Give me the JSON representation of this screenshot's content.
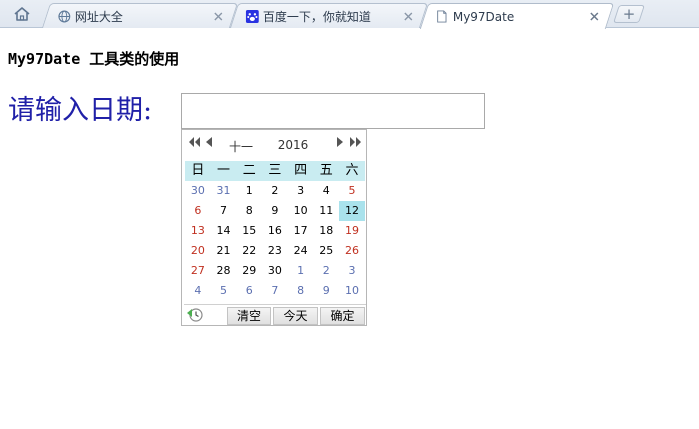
{
  "browser": {
    "tabs": [
      {
        "title": "网址大全",
        "icon": "globe-icon",
        "active": false
      },
      {
        "title": "百度一下，你就知道",
        "icon": "baidu-paw-icon",
        "active": false
      },
      {
        "title": "My97Date",
        "icon": "page-icon",
        "active": true
      }
    ],
    "new_tab_label": "+"
  },
  "page": {
    "heading": "My97Date 工具类的使用",
    "label": "请输入日期:",
    "input_value": ""
  },
  "calendar": {
    "month": "十一",
    "year": "2016",
    "weekdays": [
      "日",
      "一",
      "二",
      "三",
      "四",
      "五",
      "六"
    ],
    "weeks": [
      [
        "30",
        "31",
        "1",
        "2",
        "3",
        "4",
        "5"
      ],
      [
        "6",
        "7",
        "8",
        "9",
        "10",
        "11",
        "12"
      ],
      [
        "13",
        "14",
        "15",
        "16",
        "17",
        "18",
        "19"
      ],
      [
        "20",
        "21",
        "22",
        "23",
        "24",
        "25",
        "26"
      ],
      [
        "27",
        "28",
        "29",
        "30",
        "1",
        "2",
        "3"
      ],
      [
        "4",
        "5",
        "6",
        "7",
        "8",
        "9",
        "10"
      ]
    ],
    "selected_day": "12",
    "buttons": {
      "clear": "清空",
      "today": "今天",
      "ok": "确定"
    },
    "colors": {
      "header_bg": "#c9ecf1",
      "selected_bg": "#a9e2ec",
      "weekend": "#c03020",
      "other_month": "#5b6fb0"
    }
  }
}
